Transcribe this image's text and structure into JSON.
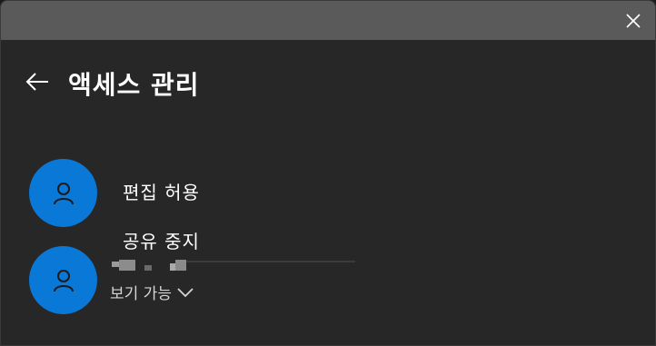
{
  "dialog": {
    "title": "액세스 관리"
  },
  "menu": {
    "items": [
      {
        "label": "편집 허용"
      },
      {
        "label": "공유 중지"
      }
    ]
  },
  "user2": {
    "permission": "보기 가능"
  },
  "colors": {
    "titlebar": "#5a5a5a",
    "background": "#272727",
    "avatar": "#0a78d7"
  },
  "icons": {
    "close": "close-icon",
    "back": "back-arrow-icon",
    "avatar": "person-icon",
    "dropdown": "chevron-down-icon"
  }
}
